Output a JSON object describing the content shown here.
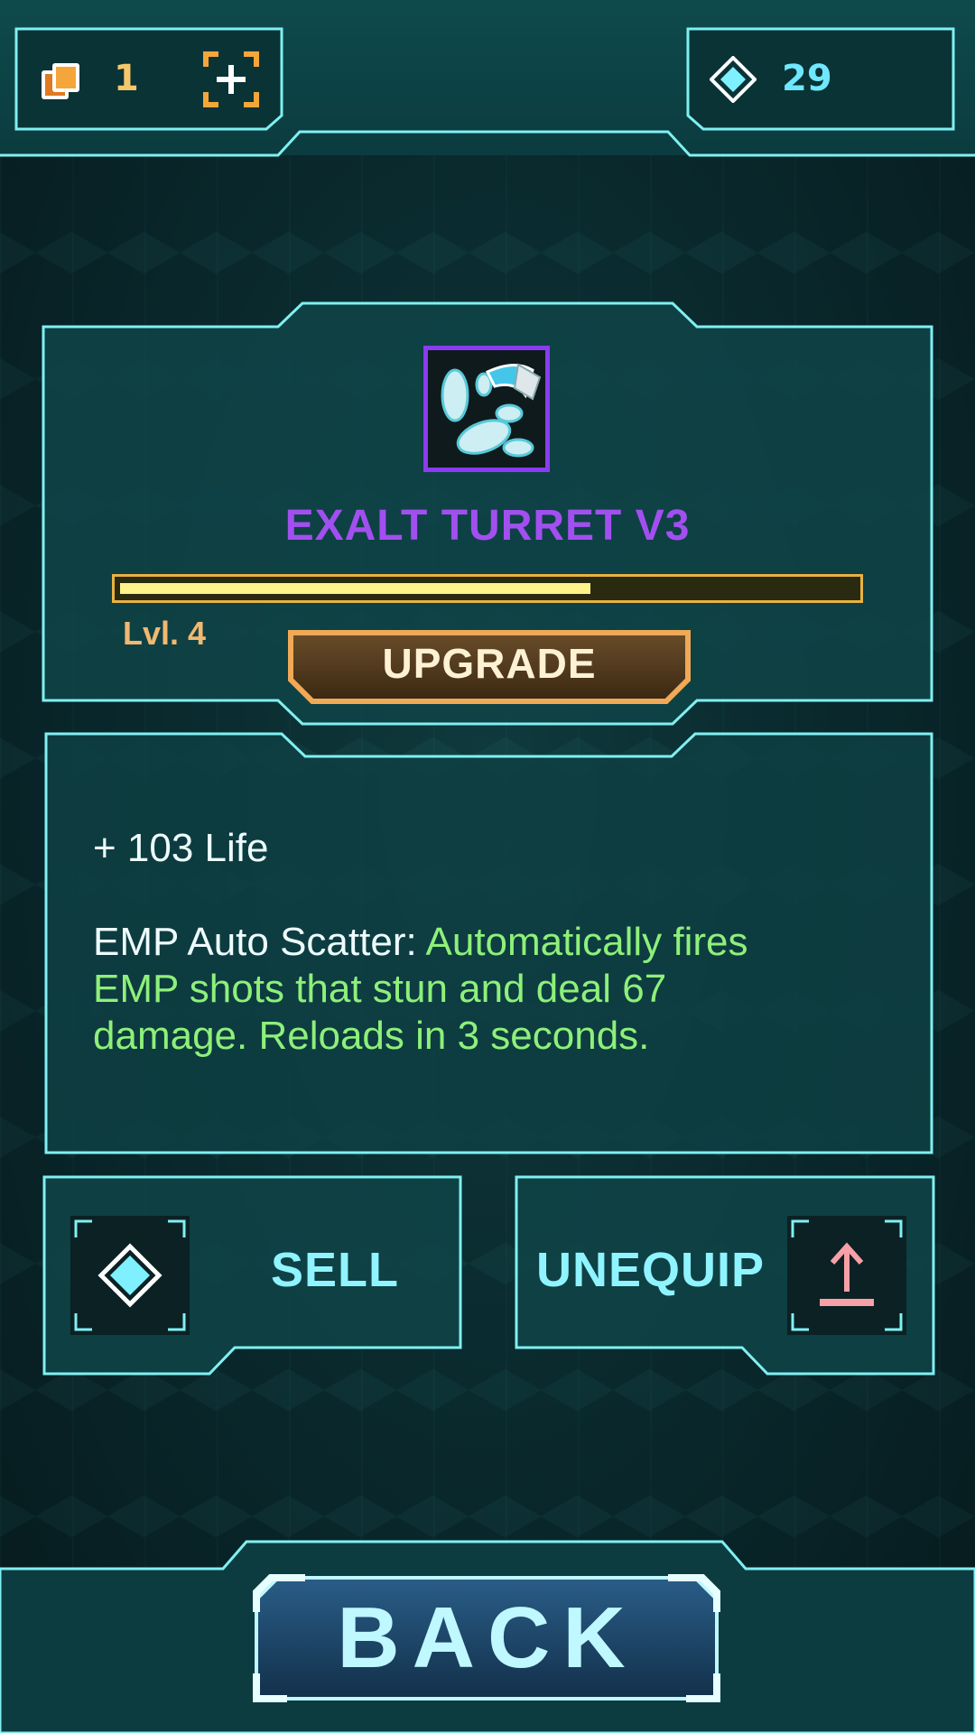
{
  "header": {
    "cards_count": "1",
    "gems_count": "29"
  },
  "item": {
    "name": "EXALT TURRET V3",
    "level_label": "Lvl. 4",
    "xp_progress": 0.64,
    "upgrade_label": "UPGRADE"
  },
  "description": {
    "stat_line": "+ 103 Life",
    "ability_name": "EMP Auto Scatter:",
    "ability_text_1": "Automatically fires",
    "ability_text_2": "EMP shots that stun and deal 67",
    "ability_text_3": "damage. Reloads in 3 seconds."
  },
  "actions": {
    "sell_label": "SELL",
    "unequip_label": "UNEQUIP",
    "back_label": "BACK"
  },
  "colors": {
    "frame": "#7ff0f2",
    "item_name": "#a24ff0",
    "ability_text": "#8ef07a",
    "upgrade_border": "#f0a957",
    "unequip_icon": "#f7a0a8"
  },
  "icons": {
    "cards": "cards-icon",
    "add": "add-frame-icon",
    "gem": "gem-icon",
    "sell": "gem-icon",
    "unequip": "upload-icon"
  }
}
